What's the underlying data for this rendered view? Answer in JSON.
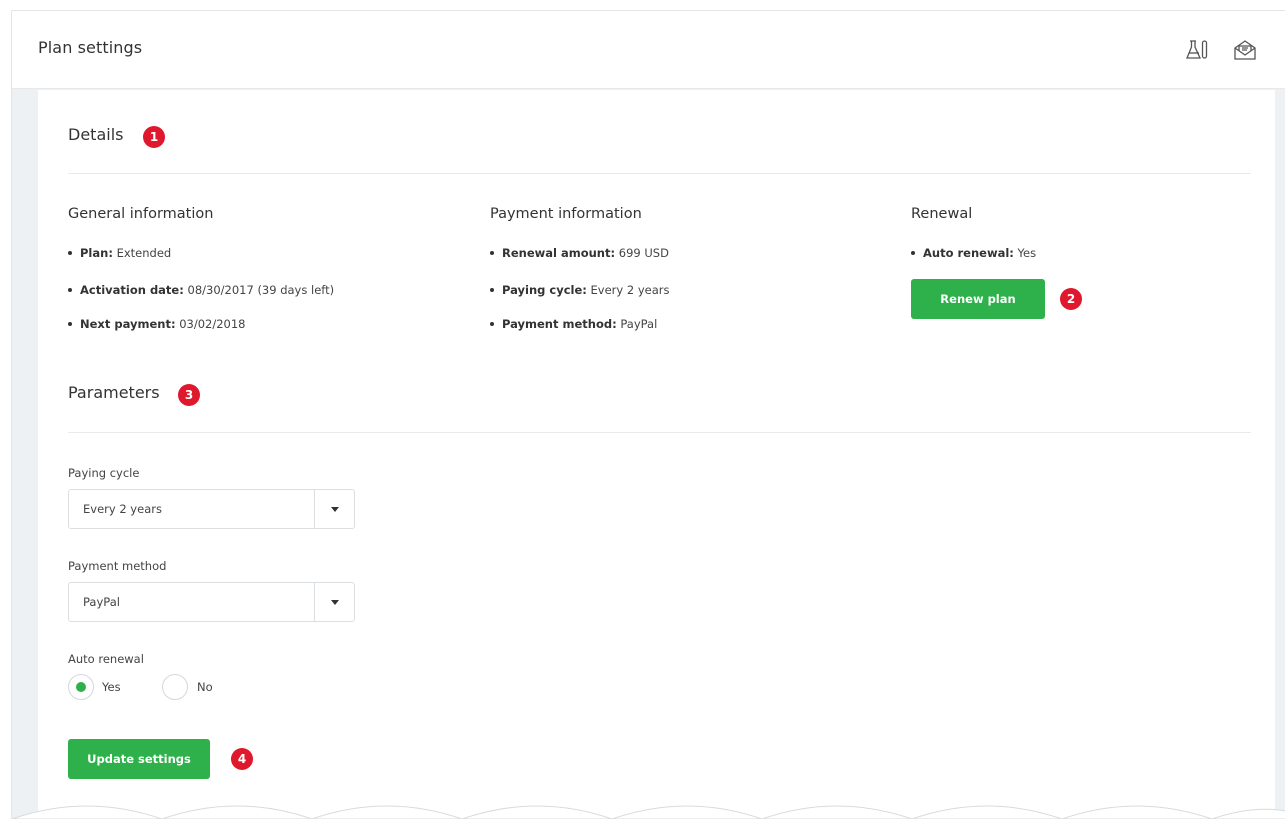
{
  "header": {
    "title": "Plan settings",
    "icons": [
      "lab-flask-icon",
      "mail-icon"
    ]
  },
  "details": {
    "title": "Details",
    "marker": "1",
    "general": {
      "title": "General information",
      "items": [
        {
          "label": "Plan:",
          "value": "Extended"
        },
        {
          "label": "Activation date:",
          "value": "08/30/2017 (39 days left)"
        },
        {
          "label": "Next payment:",
          "value": "03/02/2018"
        }
      ]
    },
    "payment": {
      "title": "Payment information",
      "items": [
        {
          "label": "Renewal amount:",
          "value": "699 USD"
        },
        {
          "label": "Paying cycle:",
          "value": "Every 2 years"
        },
        {
          "label": "Payment method:",
          "value": "PayPal"
        }
      ]
    },
    "renewal": {
      "title": "Renewal",
      "items": [
        {
          "label": "Auto renewal:",
          "value": "Yes"
        }
      ],
      "button": "Renew plan",
      "marker": "2"
    }
  },
  "parameters": {
    "title": "Parameters",
    "marker": "3",
    "paying_cycle": {
      "label": "Paying cycle",
      "value": "Every 2 years"
    },
    "payment_method": {
      "label": "Payment method",
      "value": "PayPal"
    },
    "auto_renewal": {
      "label": "Auto renewal",
      "options": [
        "Yes",
        "No"
      ],
      "selected": "Yes"
    },
    "update_button": "Update settings",
    "marker_update": "4"
  },
  "colors": {
    "accent": "#2eb14a",
    "marker": "#e0182d"
  }
}
